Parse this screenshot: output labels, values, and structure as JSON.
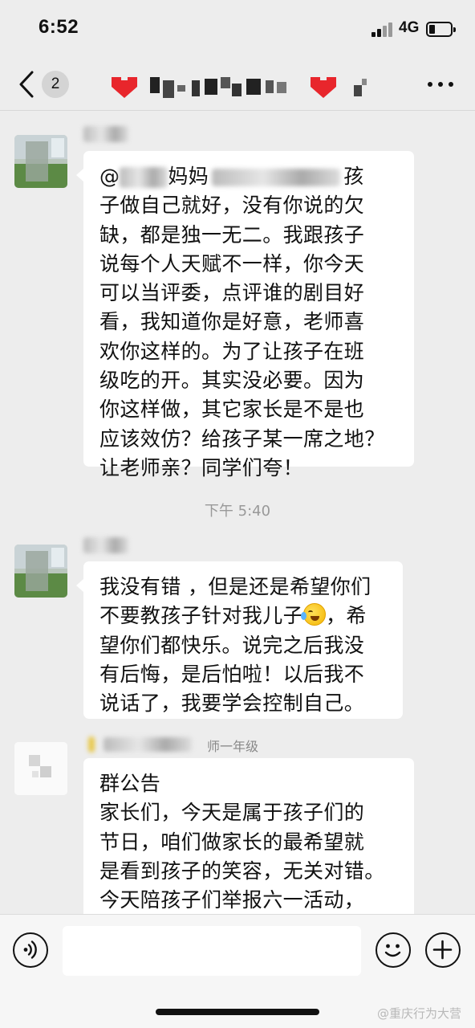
{
  "status_bar": {
    "time": "6:52",
    "network": "4G"
  },
  "nav": {
    "unread_count": "2"
  },
  "messages": [
    {
      "sender_visible": "",
      "lines_after_blur": [
        "孩",
        "子做自己就好，没有你说的欠",
        "缺，都是独一无二。我跟孩子",
        "说每个人天赋不一样，你今天",
        "可以当评委，点评谁的剧目好",
        "看，我知道你是好意，老师喜",
        "欢你这样的。为了让孩子在班",
        "级吃的开。其实没必要。因为",
        "你这样做，其它家长是不是也",
        "应该效仿？给孩子某一席之地？",
        "让老师亲？同学们夸！"
      ],
      "first_line_prefix": "@",
      "first_line_middle": "妈妈"
    },
    {
      "lines": [
        "我没有错 ，但是还是希望你们",
        "不要教孩子针对我儿子",
        "，希",
        "望你们都快乐。说完之后我没",
        "有后悔，是后怕啦！以后我不",
        "说话了，我要学会控制自己。"
      ]
    },
    {
      "sender_visible": "师一年级",
      "lines": [
        "群公告",
        "家长们，今天是属于孩子们的",
        "节日，咱们做家长的最希望就",
        "是看到孩子的笑容，无关对错。",
        "今天陪孩子们举报六一活动，"
      ]
    }
  ],
  "timestamp": "下午 5:40",
  "watermark": "@重庆行为大营",
  "colors": {
    "background": "#ededed",
    "bubble": "#ffffff",
    "timestamp": "#999999"
  }
}
